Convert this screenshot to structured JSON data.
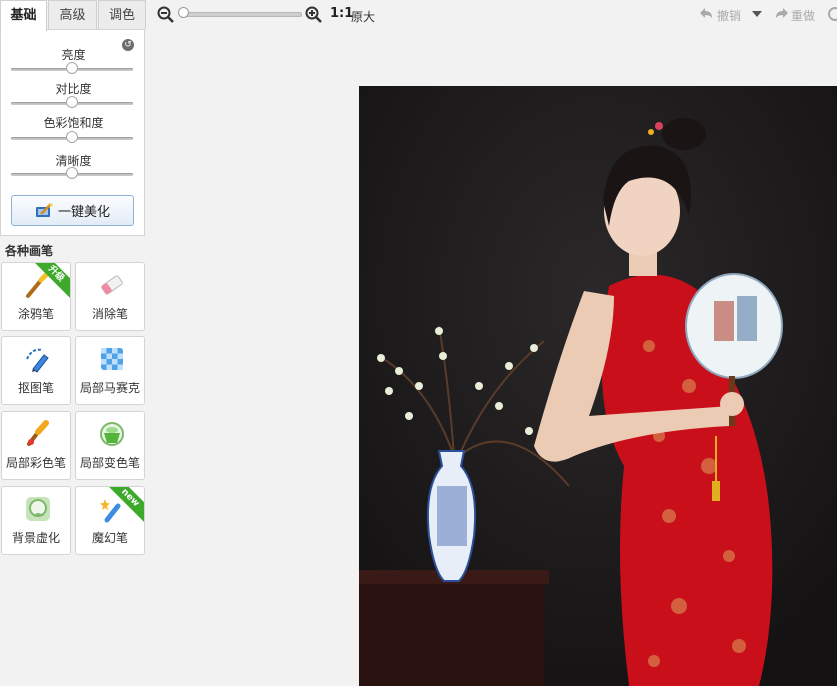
{
  "tabs": [
    {
      "label": "基础",
      "active": true
    },
    {
      "label": "高级",
      "active": false
    },
    {
      "label": "调色",
      "active": false
    }
  ],
  "adjust": {
    "sliders": [
      {
        "label": "亮度",
        "value": 0.5
      },
      {
        "label": "对比度",
        "value": 0.5
      },
      {
        "label": "色彩饱和度",
        "value": 0.5
      },
      {
        "label": "清晰度",
        "value": 0.5
      }
    ],
    "beautify_label": "一键美化"
  },
  "brushes": {
    "title": "各种画笔",
    "items": [
      {
        "label": "涂鸦笔",
        "icon": "paint-brush-icon",
        "ribbon": "升级",
        "ribbon_color": "#3daa2c"
      },
      {
        "label": "消除笔",
        "icon": "eraser-icon"
      },
      {
        "label": "抠图笔",
        "icon": "cutout-pen-icon"
      },
      {
        "label": "局部马赛克",
        "icon": "mosaic-icon"
      },
      {
        "label": "局部彩色笔",
        "icon": "color-brush-icon"
      },
      {
        "label": "局部变色笔",
        "icon": "color-change-icon"
      },
      {
        "label": "背景虚化",
        "icon": "background-blur-icon"
      },
      {
        "label": "魔幻笔",
        "icon": "magic-pen-icon",
        "ribbon": "new",
        "ribbon_color": "#3daa2c"
      }
    ]
  },
  "toolbar": {
    "zoom_level": 0,
    "ratio_label": "1:1",
    "original_label": "原大",
    "undo_label": "撤销",
    "redo_label": "重做"
  },
  "colors": {
    "accent": "#8fb3d6",
    "ribbon": "#3daa2c",
    "photo_bg": "#1d1b1c",
    "dress": "#c9101a"
  }
}
